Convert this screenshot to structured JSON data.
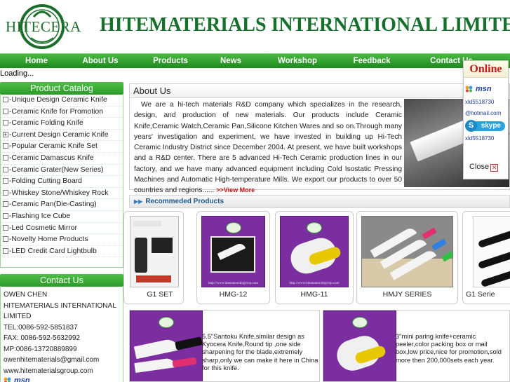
{
  "header": {
    "logo_text": "HITECERA",
    "title": "HITEMATERIALS INTERNATIONAL LIMITED"
  },
  "nav": {
    "items": [
      "Home",
      "About Us",
      "Products",
      "News",
      "Workshop",
      "Feedback",
      "Contact Us"
    ]
  },
  "loading_text": "Loading...",
  "catalog": {
    "title": "Product Catalog",
    "items": [
      "-Unique Design Ceramic Knife",
      "-Ceramic Knife for Promotion",
      "-Ceramic Folding Knife",
      "-Current Design Ceramic Knife",
      "-Popular Ceramic Knife Set",
      "-Ceramic Damascus Knife",
      "-Ceramic Grater(New Series)",
      "-Folding Cutting Board",
      "-Whiskey Stone/Whiskey Rock",
      "-Ceramic Pan(Die-Casting)",
      "-Flashing Ice Cube",
      "-Led Cosmetic Mirror",
      "-Novelty Home Products",
      "-LED Credit Card Lightbulb"
    ]
  },
  "contact": {
    "title": "Contact Us",
    "lines": [
      "OWEN CHEN",
      "HITEMATERIALS INTERNATIONAL",
      "LIMITED",
      "TEL:0086-592-5851837",
      "FAX: 0086-592-5632992",
      "MP:0086-13720889899",
      "owenhitematerials@gmail.com",
      "www.hitematerialsgroup.com"
    ],
    "msn_label": "msn"
  },
  "about": {
    "title": "About Us",
    "text": "We are a hi-tech materials R&D company which specializes in the research, design, and production of new materials. Our products include Ceramic Knife,Ceramic Watch,Ceramic Pan,Silicone Kitchen Wares and so on.Through many years' investigation and experiment, we have invested in building up Hi-Tech Ceramic Industry District since December 2004. At present, we have built workshops and a R&D center. There are 5 advanced Hi-Tech Ceramic production lines in our factory, and we have many advanced equipment including Cold Isostatic Pressing Machines and Automatic High-temperature Mills. We export our products to over 50 countries and regions......",
    "view_more": ">>View More"
  },
  "recommended": {
    "title": "Recommeded Products",
    "products": [
      {
        "label": "G1 SET"
      },
      {
        "label": "HMG-12"
      },
      {
        "label": "HMG-11"
      },
      {
        "label": "HMJY SERIES"
      },
      {
        "label": "G1 Serie"
      }
    ],
    "image_url_text": "http://www.hitematerialsgroup.com"
  },
  "features": [
    {
      "text": "5.5\"Santoku Knife,similar design as Kyocera Knife,Round tip ,one side sharpening for the blade,extremely sharp,only we can make it here in China for this knife."
    },
    {
      "text": "3\"mini paring knife+ceramic peeler,color packing box or mail box,low price,nice for promotion,sold more then 200,000sets each year."
    }
  ],
  "online": {
    "title": "Online",
    "msn_label": "msn",
    "msn_id": "xld5518730",
    "email": "@hotmail.com",
    "skype_label": "skype",
    "skype_id": "xld5518730",
    "close_label": "Close"
  },
  "colors": {
    "brand_green": "#14702a",
    "nav_green": "#2b9a2a",
    "product_purple": "#7a2ea0",
    "view_more_red": "#c21111",
    "online_red": "#c01b1b"
  }
}
